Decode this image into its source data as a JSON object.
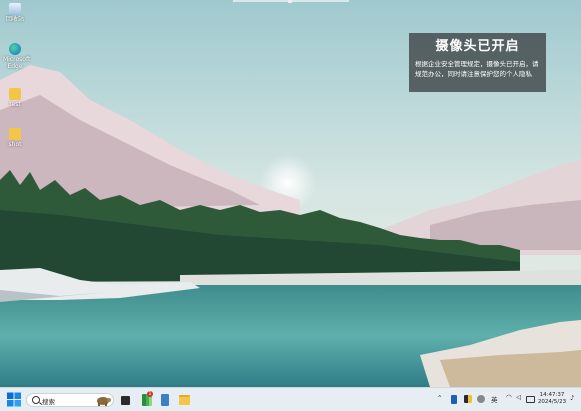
{
  "desktop": {
    "icons": [
      {
        "label": "回收站",
        "icon": "recycle-bin-icon"
      },
      {
        "label": "Microsoft Edge",
        "icon": "edge-icon"
      },
      {
        "label": "test",
        "icon": "folder-icon"
      },
      {
        "label": "shot",
        "icon": "folder-icon"
      }
    ]
  },
  "notice": {
    "title": "摄像头已开启",
    "message": "根据企业安全管理规定，摄像头已开启，请规范办公，同时请注意保护您的个人隐私"
  },
  "taskbar": {
    "search_placeholder": "搜索",
    "ime_label": "英",
    "clock_time": "14:47:37",
    "clock_date": "2024/5/23",
    "notification_badge": "1"
  },
  "colors": {
    "taskbar_bg": "#e6eef3",
    "notice_bg": "#464e50",
    "accent": "#0078d4"
  }
}
